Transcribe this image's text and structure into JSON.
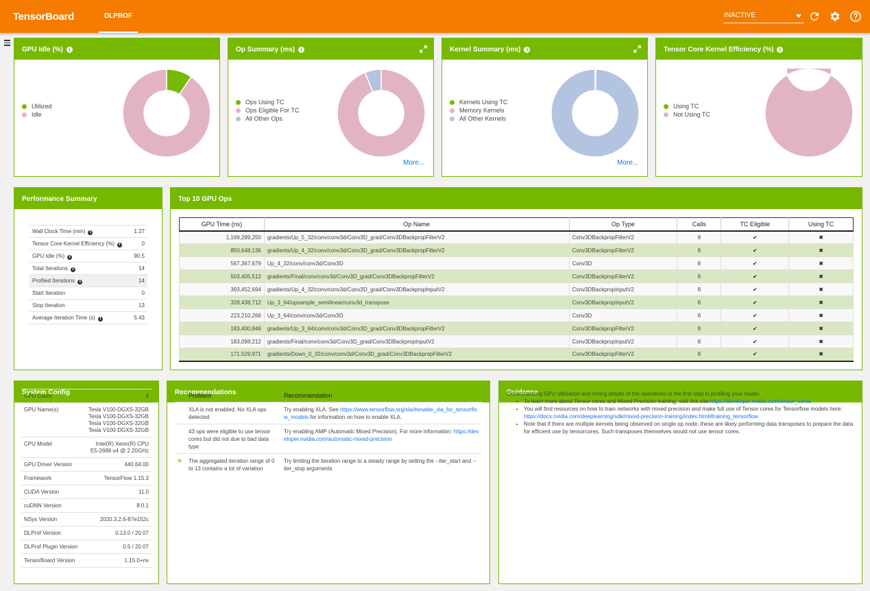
{
  "header": {
    "brand": "TensorBoard",
    "tab": "DLPROF",
    "run_selector": "INACTIVE"
  },
  "cards": {
    "gpu_idle": {
      "title": "GPU Idle (%)",
      "legend": [
        "Utilized",
        "Idle"
      ],
      "values": [
        9.5,
        90.5
      ],
      "colors": [
        "#76b900",
        "#e2b4c3"
      ]
    },
    "op_summary": {
      "title": "Op Summary (ms)",
      "legend": [
        "Ops Using TC",
        "Ops Eligible For TC",
        "All Other Ops"
      ],
      "values": [
        0,
        94,
        6
      ],
      "colors": [
        "#76b900",
        "#e2b4c3",
        "#b3c4e0"
      ],
      "more": "More..."
    },
    "kernel_summary": {
      "title": "Kernel Summary (ms)",
      "legend": [
        "Kernels Using TC",
        "Memory Kernels",
        "All Other Kernels"
      ],
      "values": [
        0,
        0.3,
        99.7
      ],
      "colors": [
        "#76b900",
        "#e2b4c3",
        "#b3c4e0"
      ],
      "more": "More..."
    },
    "tc_eff": {
      "title": "Tensor Core Kernel Efficiency (%)",
      "legend": [
        "Using TC",
        "Not Using TC"
      ],
      "values": [
        0,
        100
      ],
      "colors": [
        "#76b900",
        "#e2b4c3"
      ]
    }
  },
  "perf": {
    "title": "Performance Summary",
    "rows": [
      {
        "label": "Wall Clock Time (min)",
        "value": "1.27",
        "info": true
      },
      {
        "label": "Tensor Core Kernel Efficiency (%)",
        "value": "0",
        "info": true
      },
      {
        "label": "GPU Idle (%)",
        "value": "90.5",
        "info": true
      },
      {
        "label": "Total Iterations",
        "value": "14",
        "info": true
      },
      {
        "label": "Profiled Iterations",
        "value": "14",
        "info": true
      },
      {
        "label": "Start Iteration",
        "value": "0",
        "info": false
      },
      {
        "label": "Stop Iteration",
        "value": "13",
        "info": false
      },
      {
        "label": "Average Iteration Time (s)",
        "value": "5.43",
        "info": true
      }
    ]
  },
  "ops": {
    "title": "Top 10 GPU Ops",
    "columns": [
      "GPU Time (ns)",
      "Op Name",
      "Op Type",
      "Calls",
      "TC Eligible",
      "Using TC"
    ],
    "rows": [
      [
        "1,169,289,250",
        "gradients/Up_5_32/conv/conv3d/Conv3D_grad/Conv3DBackpropFilterV2",
        "Conv3DBackpropFilterV2",
        "8",
        "✔",
        "✖"
      ],
      [
        "850,648,136",
        "gradients/Up_4_32/conv/conv3d/Conv3D_grad/Conv3DBackpropFilterV2",
        "Conv3DBackpropFilterV2",
        "8",
        "✔",
        "✖"
      ],
      [
        "567,367,679",
        "Up_4_32/conv/conv3d/Conv3D",
        "Conv3D",
        "8",
        "✔",
        "✖"
      ],
      [
        "503,405,512",
        "gradients/Final/conv/conv3d/Conv3D_grad/Conv3DBackpropFilterV2",
        "Conv3DBackpropFilterV2",
        "8",
        "✔",
        "✖"
      ],
      [
        "393,452,694",
        "gradients/Up_4_32/conv/conv3d/Conv3D_grad/Conv3DBackpropInputV2",
        "Conv3DBackpropInputV2",
        "8",
        "✔",
        "✖"
      ],
      [
        "328,438,712",
        "Up_3_64/upsample_semilinear/conv3d_transpose",
        "Conv3DBackpropInputV2",
        "8",
        "✔",
        "✖"
      ],
      [
        "223,210,266",
        "Up_3_64/conv/conv3d/Conv3D",
        "Conv3D",
        "8",
        "✔",
        "✖"
      ],
      [
        "183,400,846",
        "gradients/Up_3_64/conv/conv3d/Conv3D_grad/Conv3DBackpropFilterV2",
        "Conv3DBackpropFilterV2",
        "8",
        "✔",
        "✖"
      ],
      [
        "183,098,212",
        "gradients/Final/conv/conv3d/Conv3D_grad/Conv3DBackpropInputV2",
        "Conv3DBackpropInputV2",
        "8",
        "✔",
        "✖"
      ],
      [
        "171,529,971",
        "gradients/Down_0_32/conv/conv3d/Conv3D_grad/Conv3DBackpropFilterV2",
        "Conv3DBackpropFilterV2",
        "8",
        "✔",
        "✖"
      ]
    ]
  },
  "system": {
    "title": "System Config",
    "rows": [
      {
        "label": "GPU Count",
        "value": [
          "4"
        ]
      },
      {
        "label": "GPU Name(s)",
        "value": [
          "Tesla V100-DGXS-32GB",
          "Tesla V100-DGXS-32GB",
          "Tesla V100-DGXS-32GB",
          "Tesla V100-DGXS-32GB"
        ]
      },
      {
        "label": "CPU Model",
        "value": [
          "Intel(R) Xeon(R) CPU",
          "E5-2698 v4 @ 2.20GHz"
        ]
      },
      {
        "label": "GPU Driver Version",
        "value": [
          "440.64.00"
        ]
      },
      {
        "label": "Framework",
        "value": [
          "TensorFlow 1.15.3"
        ]
      },
      {
        "label": "CUDA Version",
        "value": [
          "11.0"
        ]
      },
      {
        "label": "cuDNN Version",
        "value": [
          "8.0.1"
        ]
      },
      {
        "label": "NSys Version",
        "value": [
          "2020.3.2.6-87e152c"
        ]
      },
      {
        "label": "DLProf Version",
        "value": [
          "0.13.0 / 20.07"
        ]
      },
      {
        "label": "DLProf Plugin Version",
        "value": [
          "0.5 / 20.07"
        ]
      },
      {
        "label": "TensorBoard Version",
        "value": [
          "1.15.0+nv"
        ]
      }
    ]
  },
  "recs": {
    "title": "Recommendations",
    "col_problem": "Problem",
    "col_rec": "Recommendation",
    "rows": [
      {
        "problem": "XLA is not enabled: No XLA ops detected",
        "pre": "Try enabling XLA. See ",
        "link": "https://www.tensorflow.org/xla/#enable_xla_for_tensorflow_models",
        "post": " for information on how to enable XLA.",
        "chevron": false
      },
      {
        "problem": "43 ops were eligible to use tensor cores but did not due to bad data type",
        "pre": "Try enabling AMP (Automatic Mixed Precision). For more information: ",
        "link": "https://developer.nvidia.com/automatic-mixed-precision",
        "post": "",
        "chevron": false
      },
      {
        "problem": "The aggregated iteration range of 0 to 13 contains a lot of variation",
        "pre": "Try limiting the iteration range to a steady range by setting the --iter_start and --iter_stop arguments",
        "link": "",
        "post": "",
        "chevron": true
      }
    ]
  },
  "guidance": {
    "title": "Guidance",
    "intro": "Understanding GPU utilization and timing details of the operations is the first step in profiling your model.",
    "b1_pre": "To learn more about Tensor cores and Mixed Precision training, visit this site:",
    "b1_link": "https://developer.nvidia.com/tensor_cores",
    "b2_pre": "You will find resources on how to train networks with mixed precision and make full use of Tensor cores for Tensorflow models here: ",
    "b2_link": "https://docs.nvidia.com/deeplearning/sdk/mixed-precision-training/index.html#training_tensorflow",
    "b3": "Note that if there are multiple kernels being observed on single op node, these are likely performing data transposes to prepare the data for efficient use by tensorcores. Such transposes themselves would not use tensor cores."
  }
}
